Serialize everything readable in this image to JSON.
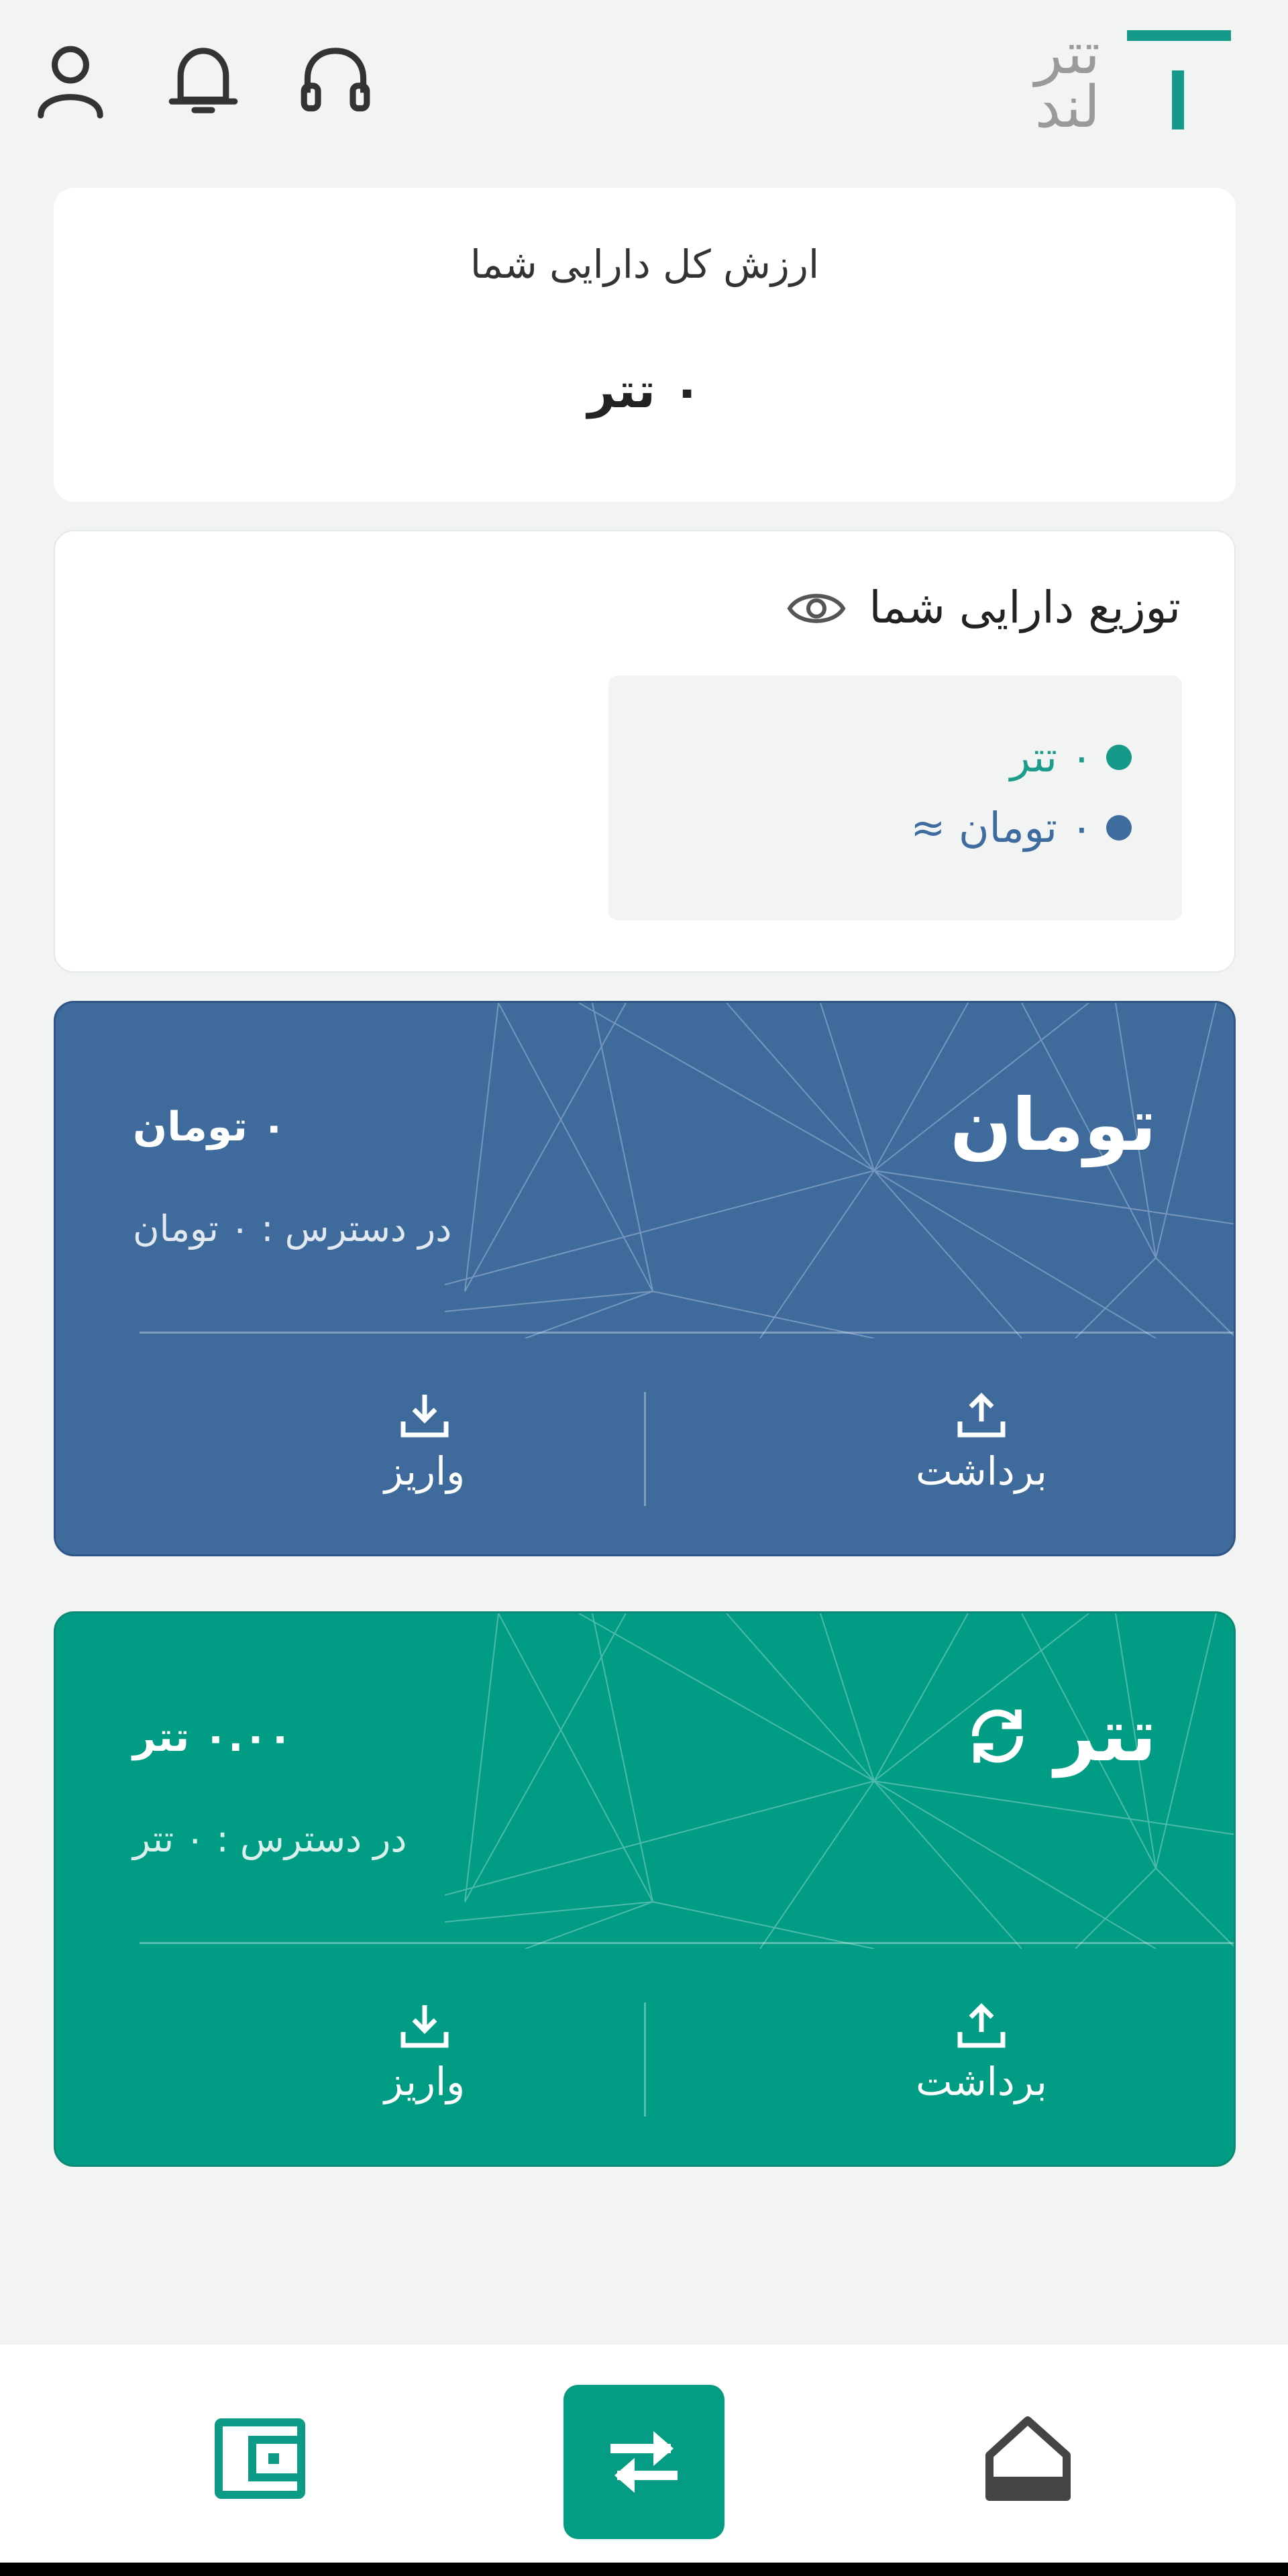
{
  "header": {
    "logo_line1": "تتر",
    "logo_line2": "لند",
    "brand_color": "#149a89",
    "icons": [
      "support-headset-icon",
      "notification-bell-icon",
      "user-profile-icon"
    ]
  },
  "total_assets": {
    "label": "ارزش کل دارایی شما",
    "value": "۰ تتر"
  },
  "distribution": {
    "title": "توزیع دارایی شما",
    "legend": [
      {
        "label": "۰ تتر",
        "color": "#159a8a"
      },
      {
        "label": "۰ تومان ≈",
        "color": "#3e6c9e"
      }
    ]
  },
  "wallets": {
    "toman": {
      "title": "تومان",
      "balance": "۰ تومان",
      "available": "در دسترس : ۰ تومان",
      "withdraw_label": "برداشت",
      "deposit_label": "واریز",
      "color": "#3e6a9c"
    },
    "usdt": {
      "title": "تتر",
      "balance": "۰.۰۰ تتر",
      "available": "در دسترس : ۰ تتر",
      "withdraw_label": "برداشت",
      "deposit_label": "واریز",
      "color": "#019c84"
    }
  },
  "bottom_nav": {
    "items": [
      "wallet-icon",
      "exchange-arrows-icon",
      "home-icon"
    ],
    "active": "exchange-arrows-icon",
    "active_color": "#059c84"
  }
}
